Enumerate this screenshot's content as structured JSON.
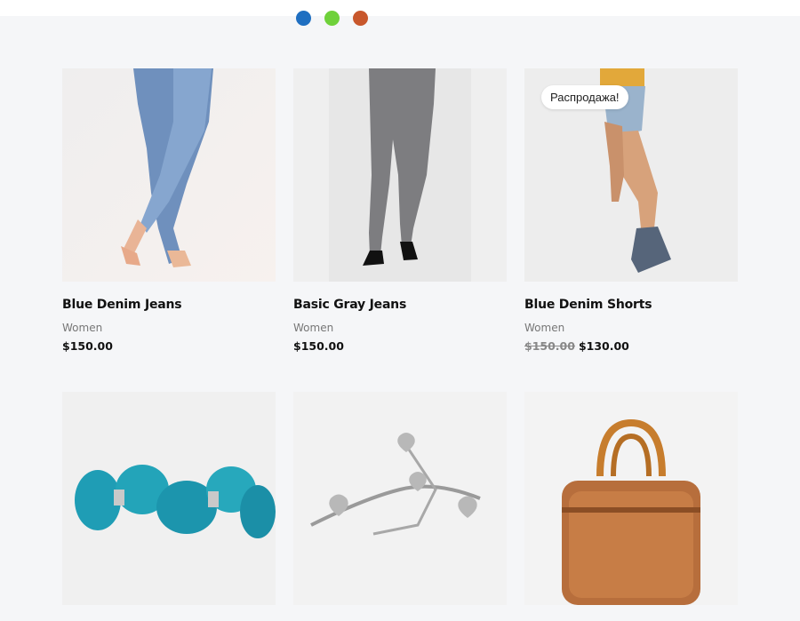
{
  "swatches": [
    {
      "name": "blue",
      "color": "#1f6fc1"
    },
    {
      "name": "green",
      "color": "#6fd13a"
    },
    {
      "name": "orange",
      "color": "#c8572c"
    }
  ],
  "products": [
    {
      "name": "Blue Denim Jeans",
      "category": "Women",
      "price": "$150.00",
      "image": "jeans-legs-photo"
    },
    {
      "name": "Basic Gray Jeans",
      "category": "Women",
      "price": "$150.00",
      "image": "gray-jeans-photo"
    },
    {
      "name": "Blue Denim Shorts",
      "category": "Women",
      "old_price": "$150.00",
      "price": "$130.00",
      "badge": "Распродажа!",
      "image": "denim-shorts-photo"
    },
    {
      "name": "",
      "category": "",
      "price": "",
      "image": "turquoise-bracelet-photo"
    },
    {
      "name": "",
      "category": "",
      "price": "",
      "image": "silver-heart-bracelet-photo"
    },
    {
      "name": "",
      "category": "",
      "price": "",
      "image": "leather-bag-photo"
    }
  ]
}
